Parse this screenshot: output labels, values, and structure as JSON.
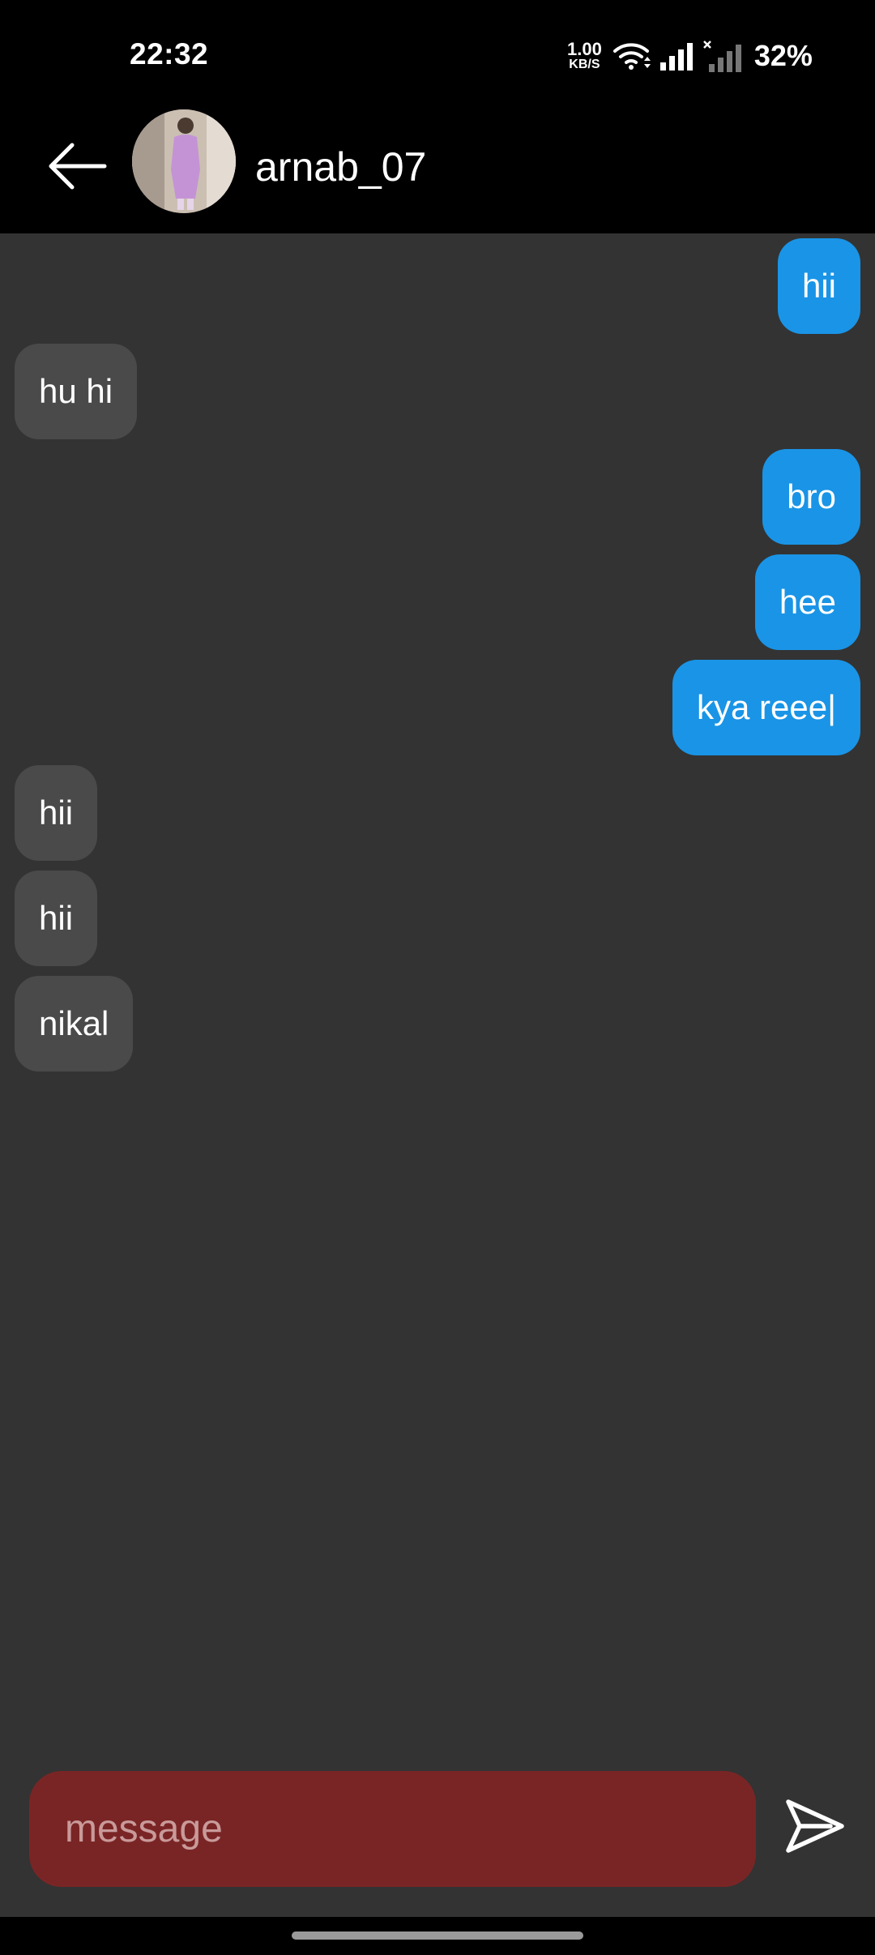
{
  "status_bar": {
    "time": "22:32",
    "net_speed_value": "1.00",
    "net_speed_unit": "KB/S",
    "battery": "32%",
    "icons": [
      "wifi-icon",
      "signal-icon",
      "signal-no-service-icon"
    ]
  },
  "header": {
    "back_icon": "arrow-left-icon",
    "contact_name": "arnab_07"
  },
  "messages": [
    {
      "from": "me",
      "text": "hii"
    },
    {
      "from": "them",
      "text": "hu hi"
    },
    {
      "from": "me",
      "text": "bro"
    },
    {
      "from": "me",
      "text": "hee"
    },
    {
      "from": "me",
      "text": "kya reee|"
    },
    {
      "from": "them",
      "text": "hii"
    },
    {
      "from": "them",
      "text": "hii"
    },
    {
      "from": "them",
      "text": "nikal"
    }
  ],
  "composer": {
    "placeholder": "message",
    "value": "",
    "send_icon": "send-icon"
  },
  "colors": {
    "sent_bubble": "#1a94e6",
    "received_bubble": "#4a4a4a",
    "chat_background": "#333333",
    "input_background": "#7a2525"
  }
}
